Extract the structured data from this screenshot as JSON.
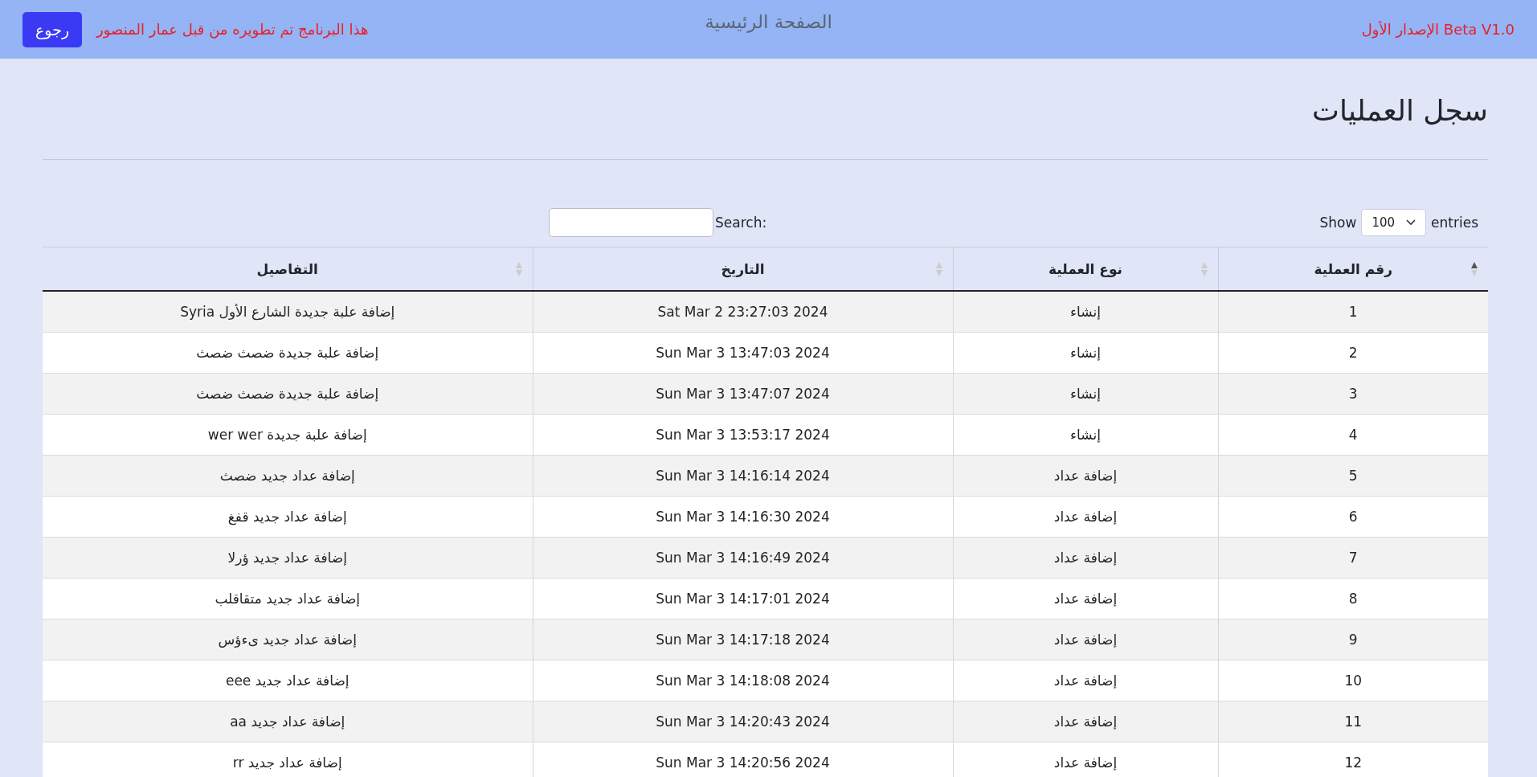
{
  "navbar": {
    "back_button": "رجوع",
    "credit": "هذا البرنامج تم تطويره من قبل عمار المنصور",
    "title": "الصفحة الرئيسية",
    "version": "الإصدار الأول Beta V1.0"
  },
  "page_title": "سجل العمليات",
  "length_control": {
    "show_label": "Show",
    "value": "100",
    "entries_label": "entries"
  },
  "search": {
    "label": "Search:"
  },
  "table": {
    "columns": [
      {
        "label": "رقم العملية",
        "sorted": true
      },
      {
        "label": "نوع العملية",
        "sorted": false
      },
      {
        "label": "التاريخ",
        "sorted": false
      },
      {
        "label": "التفاصيل",
        "sorted": false
      }
    ],
    "rows": [
      [
        "1",
        "إنشاء",
        "Sat Mar 2 23:27:03 2024",
        "إضافة علبة جديدة الشارع الأول Syria"
      ],
      [
        "2",
        "إنشاء",
        "Sun Mar 3 13:47:03 2024",
        "إضافة علبة جديدة ضصث ضصث"
      ],
      [
        "3",
        "إنشاء",
        "Sun Mar 3 13:47:07 2024",
        "إضافة علبة جديدة ضصث ضصث"
      ],
      [
        "4",
        "إنشاء",
        "Sun Mar 3 13:53:17 2024",
        "إضافة علبة جديدة wer wer"
      ],
      [
        "5",
        "إضافة عداد",
        "Sun Mar 3 14:16:14 2024",
        "إضافة عداد جديد ضصث"
      ],
      [
        "6",
        "إضافة عداد",
        "Sun Mar 3 14:16:30 2024",
        "إضافة عداد جديد قفغ"
      ],
      [
        "7",
        "إضافة عداد",
        "Sun Mar 3 14:16:49 2024",
        "إضافة عداد جديد ؤرلا"
      ],
      [
        "8",
        "إضافة عداد",
        "Sun Mar 3 14:17:01 2024",
        "إضافة عداد جديد متقاقلب"
      ],
      [
        "9",
        "إضافة عداد",
        "Sun Mar 3 14:17:18 2024",
        "إضافة عداد جديد ىءؤس"
      ],
      [
        "10",
        "إضافة عداد",
        "Sun Mar 3 14:18:08 2024",
        "إضافة عداد جديد eee"
      ],
      [
        "11",
        "إضافة عداد",
        "Sun Mar 3 14:20:43 2024",
        "إضافة عداد جديد aa"
      ],
      [
        "12",
        "إضافة عداد",
        "Sun Mar 3 14:20:56 2024",
        "إضافة عداد جديد rr"
      ]
    ]
  }
}
